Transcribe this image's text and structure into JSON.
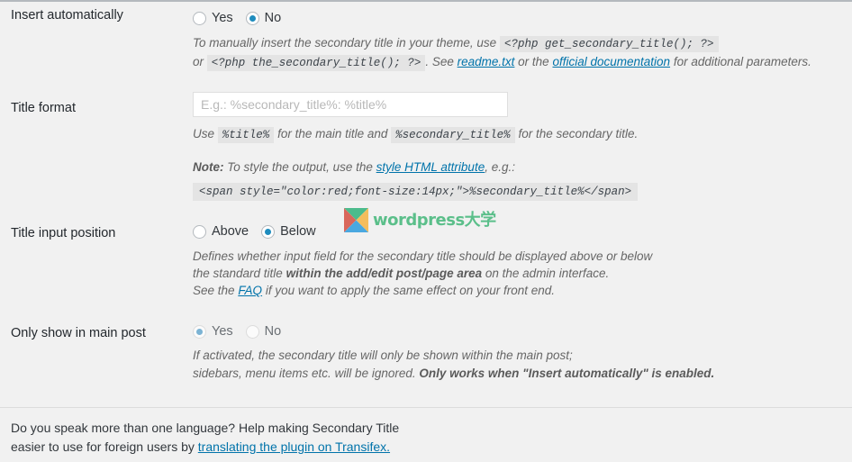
{
  "page": {
    "background_color": "#f1f1f1",
    "link_color": "#0073aa",
    "accent_color": "#1e8cbe"
  },
  "settings": {
    "insert_automatically": {
      "label": "Insert automatically",
      "options": [
        {
          "label": "Yes",
          "selected": false
        },
        {
          "label": "No",
          "selected": true
        }
      ],
      "description": {
        "line1_pre": "To manually insert the secondary title in your theme, use",
        "code1": "<?php get_secondary_title(); ?>",
        "line2_pre": "or",
        "code2": "<?php the_secondary_title(); ?>",
        "line2_mid": ". See",
        "link1": "readme.txt",
        "line2_mid2": "or the",
        "link2": "official documentation",
        "line2_post": "for additional parameters."
      }
    },
    "title_format": {
      "label": "Title format",
      "input_value": "",
      "input_placeholder": "E.g.: %secondary_title%: %title%",
      "hint_pre": "Use",
      "hint_code1": "%title%",
      "hint_mid": "for the main title and",
      "hint_code2": "%secondary_title%",
      "hint_post": "for the secondary title.",
      "note_label": "Note:",
      "note_pre": "To style the output, use the",
      "note_link": "style HTML attribute",
      "note_post": ", e.g.:",
      "note_code": "<span style=\"color:red;font-size:14px;\">%secondary_title%</span>"
    },
    "title_input_position": {
      "label": "Title input position",
      "options": [
        {
          "label": "Above",
          "selected": false
        },
        {
          "label": "Below",
          "selected": true
        }
      ],
      "desc_line1": "Defines whether input field for the secondary title should be displayed above or below",
      "desc_line2_pre": "the standard title",
      "desc_line2_bold": "within the add/edit post/page area",
      "desc_line2_post": "on the admin interface.",
      "desc_line3_pre": "See the",
      "desc_line3_link": "FAQ",
      "desc_line3_post": "if you want to apply the same effect on your front end."
    },
    "only_show_in_main_post": {
      "label": "Only show in main post",
      "disabled": true,
      "options": [
        {
          "label": "Yes",
          "selected": true
        },
        {
          "label": "No",
          "selected": false
        }
      ],
      "desc_line1": "If activated, the secondary title will only be shown within the main post;",
      "desc_line2_pre": "sidebars, menu items etc. will be ignored.",
      "desc_line2_bold": "Only works when \"Insert automatically\" is enabled."
    }
  },
  "watermark": {
    "brand_text": "wordpress大学",
    "mark_colors": {
      "top": "#4cbb8c",
      "left": "#d9675b",
      "right": "#f5bd5c",
      "bottom": "#4aa8e0"
    }
  },
  "footer": {
    "line1": "Do you speak more than one language? Help making Secondary Title",
    "line2_pre": "easier to use for foreign users by",
    "line2_link": "translating the plugin on Transifex."
  }
}
